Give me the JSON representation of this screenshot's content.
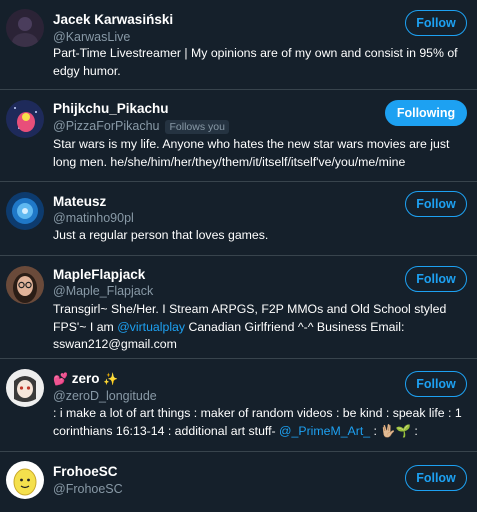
{
  "users": [
    {
      "name": "Jacek Karwasiński",
      "handle": "@KarwasLive",
      "bio": "Part-Time Livestreamer | My opinions are of my own and consist in 95% of edgy humor.",
      "button": "Follow"
    },
    {
      "name": "Phijkchu_Pikachu",
      "handle": "@PizzaForPikachu",
      "follows_you": "Follows you",
      "bio": "Star wars is my life. Anyone who hates the new star wars movies are just long men. he/she/him/her/they/them/it/itself/itself've/you/me/mine",
      "button": "Following"
    },
    {
      "name": "Mateusz",
      "handle": "@matinho90pl",
      "bio": "Just a regular person that loves games.",
      "button": "Follow"
    },
    {
      "name": "MapleFlapjack",
      "handle": "@Maple_Flapjack",
      "bio_parts": [
        "Transgirl~ She/Her. I Stream ARPGS, F2P MMOs and Old School styled FPS'~ I am ",
        "@virtualplay",
        " Canadian Girlfriend ^-^ Business Email: sswan212@gmail.com"
      ],
      "button": "Follow"
    },
    {
      "name_prefix_emoji": "💕",
      "name": "zero",
      "name_suffix_emoji": "✨",
      "handle": "@zeroD_longitude",
      "bio_parts": [
        ": i make a lot of art things : maker of random videos : be kind : speak life : 1 corinthians 16:13-14 : additional art stuff- ",
        "@_PrimeM_Art_",
        " : 🖖🏼🌱 :"
      ],
      "button": "Follow"
    },
    {
      "name": "FrohoeSC",
      "handle": "@FrohoeSC",
      "button": "Follow"
    }
  ],
  "colors": {
    "background": "#15202b",
    "accent": "#1da1f2",
    "secondary_text": "#8899a6",
    "divider": "#38444d"
  },
  "icons": {
    "avatar_0": "dark-purple-avatar",
    "avatar_1": "pikachu-space-avatar",
    "avatar_2": "blue-swirl-avatar",
    "avatar_3": "woman-glasses-avatar",
    "avatar_4": "anime-character-avatar",
    "avatar_5": "lemon-character-avatar"
  }
}
